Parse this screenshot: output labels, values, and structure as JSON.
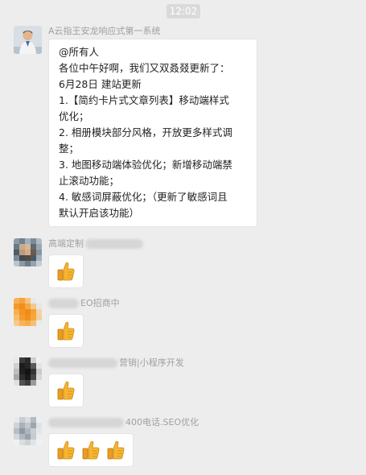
{
  "chat": {
    "time": "12:02",
    "messages": [
      {
        "sender": "A云指王安龙响应式第一系统",
        "lines": [
          "@所有人",
          "各位中午好啊，我们又双叒叕更新了：",
          "6月28日   建站更新",
          "1.【简约卡片式文章列表】移动端样式",
          "优化；",
          "2. 相册模块部分风格，开放更多样式调",
          "整；",
          "3. 地图移动端体验优化；新增移动端禁",
          "止滚动功能；",
          "4. 敏感词屏蔽优化；（更新了敏感词且",
          "默认开启该功能）"
        ]
      },
      {
        "sender_prefix": "高端定制",
        "sender_suffix": "",
        "thumb_count": 1
      },
      {
        "sender_prefix": "",
        "sender_suffix": "EO招商中",
        "thumb_count": 1
      },
      {
        "sender_prefix": "",
        "sender_suffix": "营销|小程序开发",
        "thumb_count": 1
      },
      {
        "sender_prefix": "",
        "sender_suffix": "400电话.SEO优化",
        "thumb_count": 3
      }
    ]
  },
  "icons": {
    "reaction": "thumbs-up-icon"
  },
  "colors": {
    "background": "#ededed",
    "bubble": "#ffffff",
    "sender_text": "#a0a0a0",
    "thumb": "#f5b533"
  }
}
